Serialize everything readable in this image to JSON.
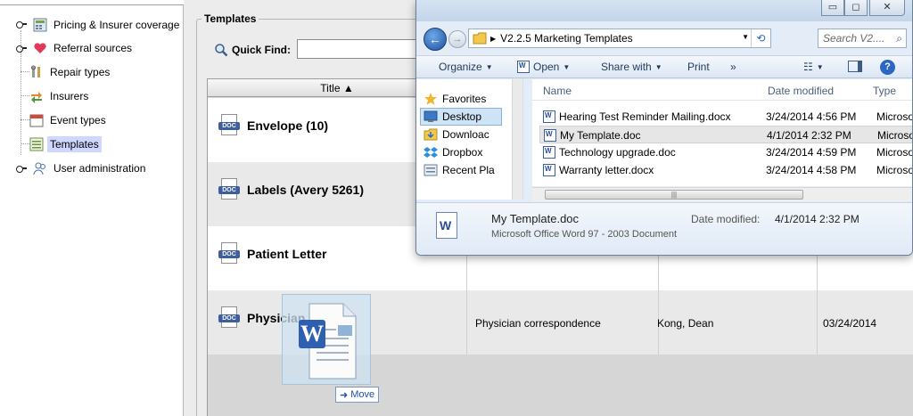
{
  "tree": {
    "items": [
      {
        "label": "Pricing & Insurer coverage",
        "icon": "calculator-icon"
      },
      {
        "label": "Referral sources",
        "icon": "heart-icon"
      },
      {
        "label": "Repair types",
        "icon": "tools-icon"
      },
      {
        "label": "Insurers",
        "icon": "arrows-icon"
      },
      {
        "label": "Event types",
        "icon": "calendar-icon"
      },
      {
        "label": "Templates",
        "icon": "template-icon"
      },
      {
        "label": "User administration",
        "icon": "users-icon"
      }
    ]
  },
  "templates": {
    "group_title": "Templates",
    "quick_find_label": "Quick Find:",
    "quick_find_value": "",
    "column_title": "Title ▲",
    "doc_tag": "DOC",
    "rows": [
      {
        "title": "Envelope (10)",
        "description": "",
        "author": "",
        "date": ""
      },
      {
        "title": "Labels (Avery 5261)",
        "description": "",
        "author": "",
        "date": ""
      },
      {
        "title": "Patient Letter",
        "description": "",
        "author": "",
        "date": ""
      },
      {
        "title": "Physician letter",
        "description": "Physician correspondence",
        "author": "Kong, Dean",
        "date": "03/24/2014"
      }
    ]
  },
  "drag": {
    "badge_label": "Move"
  },
  "explorer": {
    "window_buttons": {
      "minimize": "▭",
      "maximize": "◻",
      "close": "✕"
    },
    "address_path": "V2.2.5 Marketing Templates",
    "search_placeholder": "Search V2....",
    "toolbar": {
      "organize": "Organize",
      "open": "Open",
      "share_with": "Share with",
      "print": "Print",
      "more": "»"
    },
    "nav_pane": [
      {
        "label": "Favorites",
        "icon": "star-icon"
      },
      {
        "label": "Desktop",
        "icon": "desktop-icon"
      },
      {
        "label": "Downloac",
        "icon": "downloads-icon"
      },
      {
        "label": "Dropbox",
        "icon": "dropbox-icon"
      },
      {
        "label": "Recent Pla",
        "icon": "recent-places-icon"
      }
    ],
    "columns": {
      "name": "Name",
      "date": "Date modified",
      "type": "Type"
    },
    "files": [
      {
        "name": "Hearing Test Reminder Mailing.docx",
        "date": "3/24/2014 4:56 PM",
        "type": "Microso"
      },
      {
        "name": "My Template.doc",
        "date": "4/1/2014 2:32 PM",
        "type": "Microso"
      },
      {
        "name": "Technology upgrade.doc",
        "date": "3/24/2014 4:59 PM",
        "type": "Microso"
      },
      {
        "name": "Warranty letter.docx",
        "date": "3/24/2014 4:58 PM",
        "type": "Microso"
      }
    ],
    "details": {
      "name": "My Template.doc",
      "type": "Microsoft Office Word 97 - 2003 Document",
      "date_label": "Date modified:",
      "date_value": "4/1/2014 2:32 PM"
    }
  }
}
